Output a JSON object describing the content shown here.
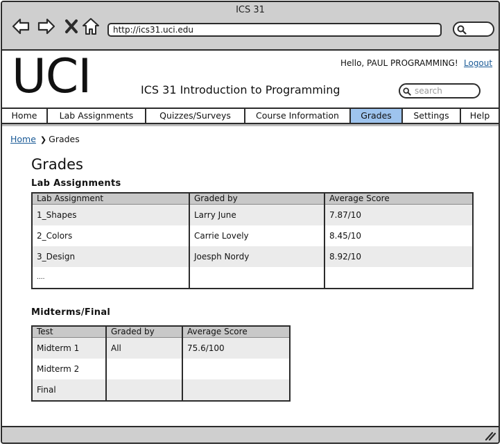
{
  "window": {
    "title": "ICS 31"
  },
  "browser": {
    "url": "http://ics31.uci.edu",
    "nav_icons": [
      "back-arrow-icon",
      "forward-arrow-icon",
      "close-x-icon",
      "home-icon"
    ],
    "search_icon": "search-icon"
  },
  "header": {
    "logo": "UCI",
    "site_title": "ICS 31 Introduction to Programming",
    "greeting": "Hello, PAUL PROGRAMMING!",
    "logout": "Logout",
    "search_placeholder": "search"
  },
  "tabs": [
    {
      "label": "Home"
    },
    {
      "label": "Lab Assignments"
    },
    {
      "label": "Quizzes/Surveys"
    },
    {
      "label": "Course Information"
    },
    {
      "label": "Grades",
      "active": true
    },
    {
      "label": "Settings"
    },
    {
      "label": "Help"
    }
  ],
  "breadcrumb": {
    "home": "Home",
    "current": "Grades"
  },
  "page_title": "Grades",
  "labs": {
    "title": "Lab Assignments",
    "columns": [
      "Lab Assignment",
      "Graded by",
      "Average Score"
    ],
    "rows": [
      [
        "1_Shapes",
        "Larry June",
        "7.87/10"
      ],
      [
        "2_Colors",
        "Carrie Lovely",
        "8.45/10"
      ],
      [
        "3_Design",
        "Joesph Nordy",
        "8.92/10"
      ],
      [
        "....",
        "",
        ""
      ]
    ]
  },
  "exams": {
    "title": "Midterms/Final",
    "columns": [
      "Test",
      "Graded by",
      "Average Score"
    ],
    "rows": [
      [
        "Midterm 1",
        "All",
        "75.6/100"
      ],
      [
        "Midterm 2",
        "",
        ""
      ],
      [
        "Final",
        "",
        ""
      ]
    ]
  },
  "colors": {
    "active_tab": "#9ec4ee",
    "link": "#1a5a96",
    "chrome": "#cfcfcf"
  }
}
